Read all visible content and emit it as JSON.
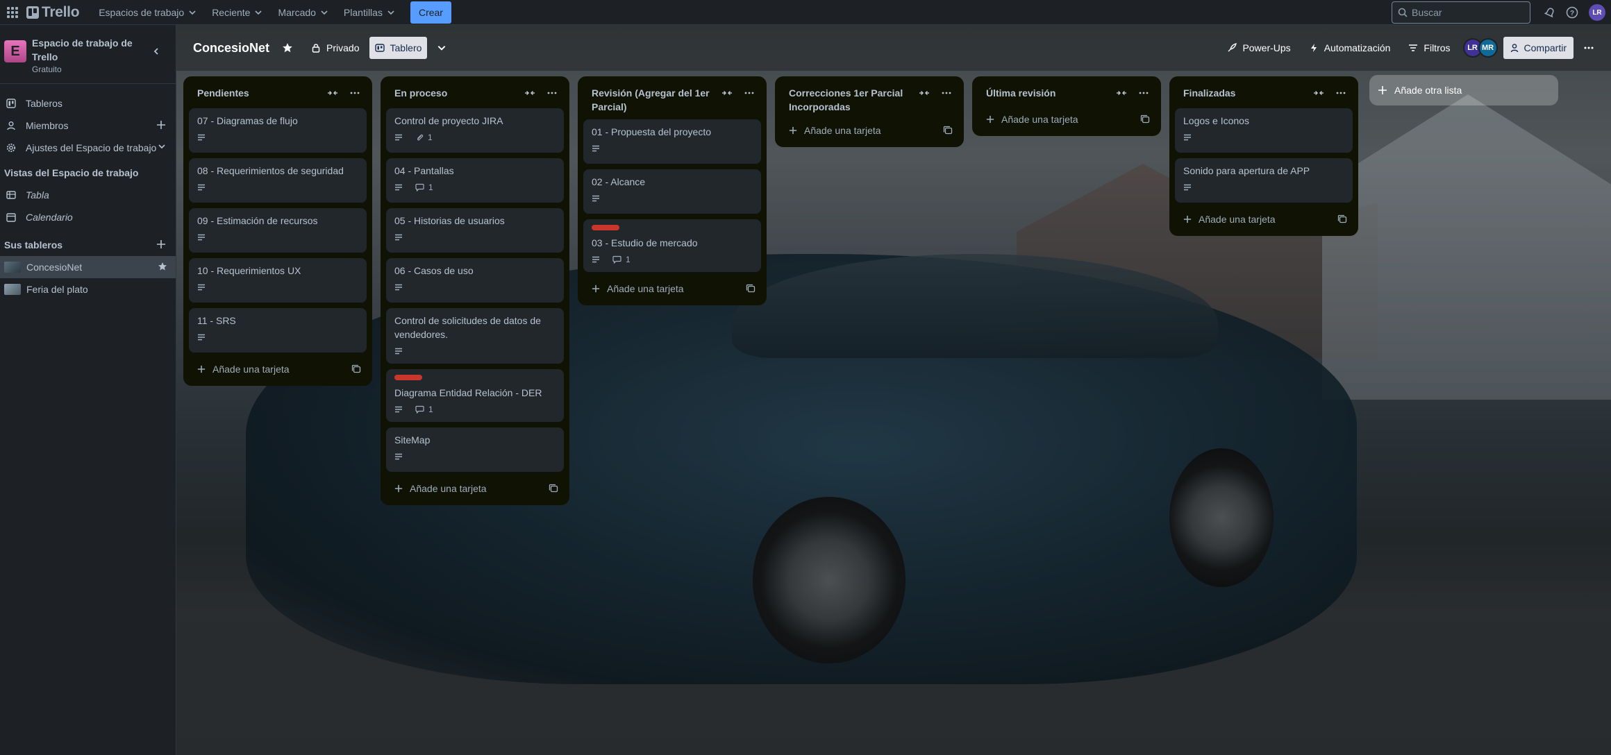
{
  "topbar": {
    "logo_text": "Trello",
    "menus": [
      "Espacios de trabajo",
      "Reciente",
      "Marcado",
      "Plantillas"
    ],
    "create_label": "Crear",
    "search_placeholder": "Buscar",
    "user_initials": "LR"
  },
  "sidebar": {
    "workspace_initial": "E",
    "workspace_name": "Espacio de trabajo de Trello",
    "workspace_plan": "Gratuito",
    "items": [
      {
        "label": "Tableros"
      },
      {
        "label": "Miembros"
      },
      {
        "label": "Ajustes del Espacio de trabajo"
      }
    ],
    "views_heading": "Vistas del Espacio de trabajo",
    "views": [
      {
        "label": "Tabla"
      },
      {
        "label": "Calendario"
      }
    ],
    "boards_heading": "Sus tableros",
    "boards": [
      {
        "label": "ConcesioNet",
        "active": true
      },
      {
        "label": "Feria del plato",
        "active": false
      }
    ]
  },
  "board": {
    "name": "ConcesioNet",
    "visibility": "Privado",
    "view": "Tablero",
    "power_ups": "Power-Ups",
    "automation": "Automatización",
    "filters": "Filtros",
    "members": [
      "LR",
      "MR"
    ],
    "share": "Compartir",
    "add_list": "Añade otra lista",
    "add_card": "Añade una tarjeta",
    "label_color": "#c9372c"
  },
  "lists": [
    {
      "title": "Pendientes",
      "cards": [
        {
          "title": "07 - Diagramas de flujo"
        },
        {
          "title": "08 - Requerimientos de seguridad"
        },
        {
          "title": "09 - Estimación de recursos"
        },
        {
          "title": "10 - Requerimientos UX"
        },
        {
          "title": "11 - SRS"
        }
      ]
    },
    {
      "title": "En proceso",
      "cards": [
        {
          "title": "Control de proyecto JIRA",
          "attachments": "1"
        },
        {
          "title": "04 - Pantallas",
          "comments": "1"
        },
        {
          "title": "05 - Historias de usuarios"
        },
        {
          "title": "06 - Casos de uso"
        },
        {
          "title": "Control de solicitudes de datos de vendedores."
        },
        {
          "title": "Diagrama Entidad Relación - DER",
          "label": true,
          "comments": "1"
        },
        {
          "title": "SiteMap"
        }
      ]
    },
    {
      "title": "Revisión (Agregar del 1er Parcial)",
      "cards": [
        {
          "title": "01 - Propuesta del proyecto"
        },
        {
          "title": "02 - Alcance"
        },
        {
          "title": "03 - Estudio de mercado",
          "label": true,
          "comments": "1"
        }
      ]
    },
    {
      "title": "Correcciones 1er Parcial Incorporadas",
      "cards": []
    },
    {
      "title": "Última revisión",
      "cards": []
    },
    {
      "title": "Finalizadas",
      "cards": [
        {
          "title": "Logos e Iconos"
        },
        {
          "title": "Sonido para apertura de APP"
        }
      ]
    }
  ]
}
